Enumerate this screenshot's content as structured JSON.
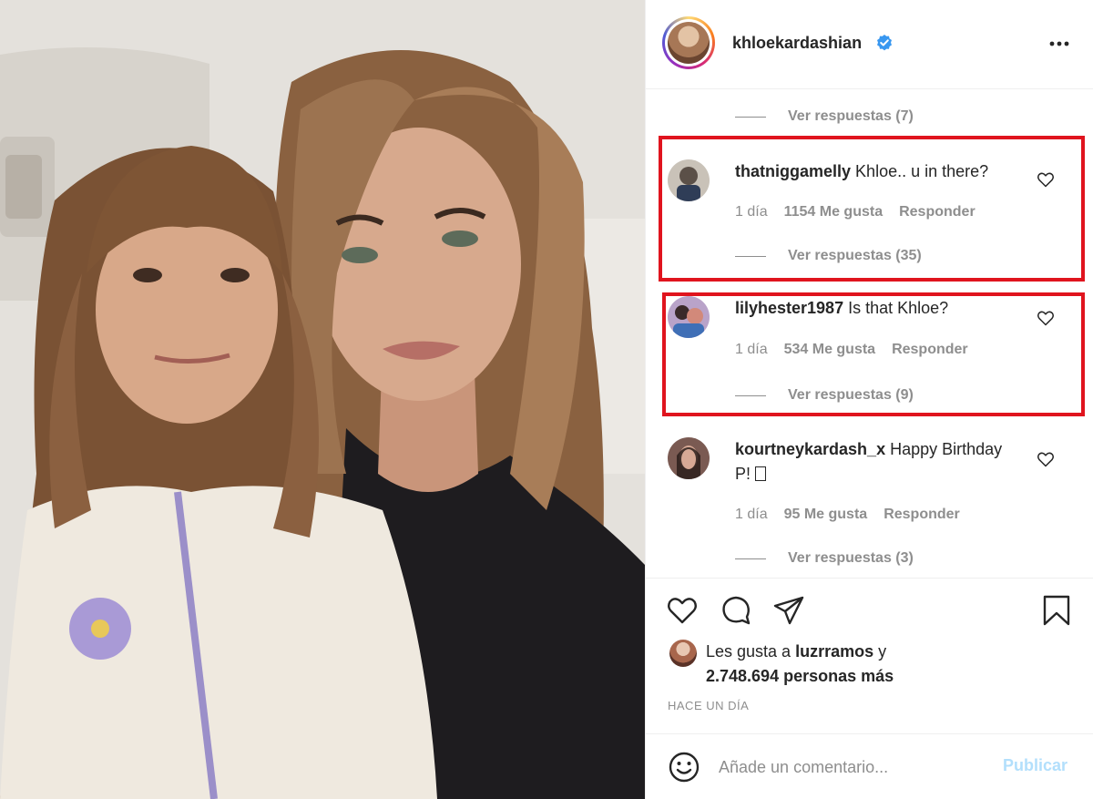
{
  "header": {
    "username": "khloekardashian",
    "verified": true,
    "more_icon": "more-horizontal-icon"
  },
  "comments": {
    "prev_replies": "Ver respuestas (7)",
    "items": [
      {
        "username": "thatniggamelly",
        "text": "Khloe.. u in there?",
        "time": "1 día",
        "likes": "1154 Me gusta",
        "reply": "Responder",
        "replies": "Ver respuestas (35)",
        "highlighted": true
      },
      {
        "username": "lilyhester1987",
        "text": "Is that Khloe?",
        "time": "1 día",
        "likes": "534 Me gusta",
        "reply": "Responder",
        "replies": "Ver respuestas (9)",
        "highlighted": true
      },
      {
        "username": "kourtneykardash_x",
        "text": "Happy Birthday P! ",
        "time": "1 día",
        "likes": "95 Me gusta",
        "reply": "Responder",
        "replies": "Ver respuestas (3)",
        "highlighted": false
      }
    ]
  },
  "actions": {
    "icons": [
      "heart-icon",
      "comment-icon",
      "share-icon",
      "bookmark-icon"
    ],
    "likes_prefix": "Les gusta a ",
    "likes_user": "luzrramos",
    "likes_mid": " y",
    "likes_count": "2.748.694 personas más",
    "timestamp": "HACE UN DÍA"
  },
  "add_comment": {
    "placeholder": "Añade un comentario...",
    "publish_label": "Publicar"
  },
  "colors": {
    "highlight": "#e0141e",
    "verified": "#3897f0",
    "publish_disabled": "#b2dffc"
  }
}
